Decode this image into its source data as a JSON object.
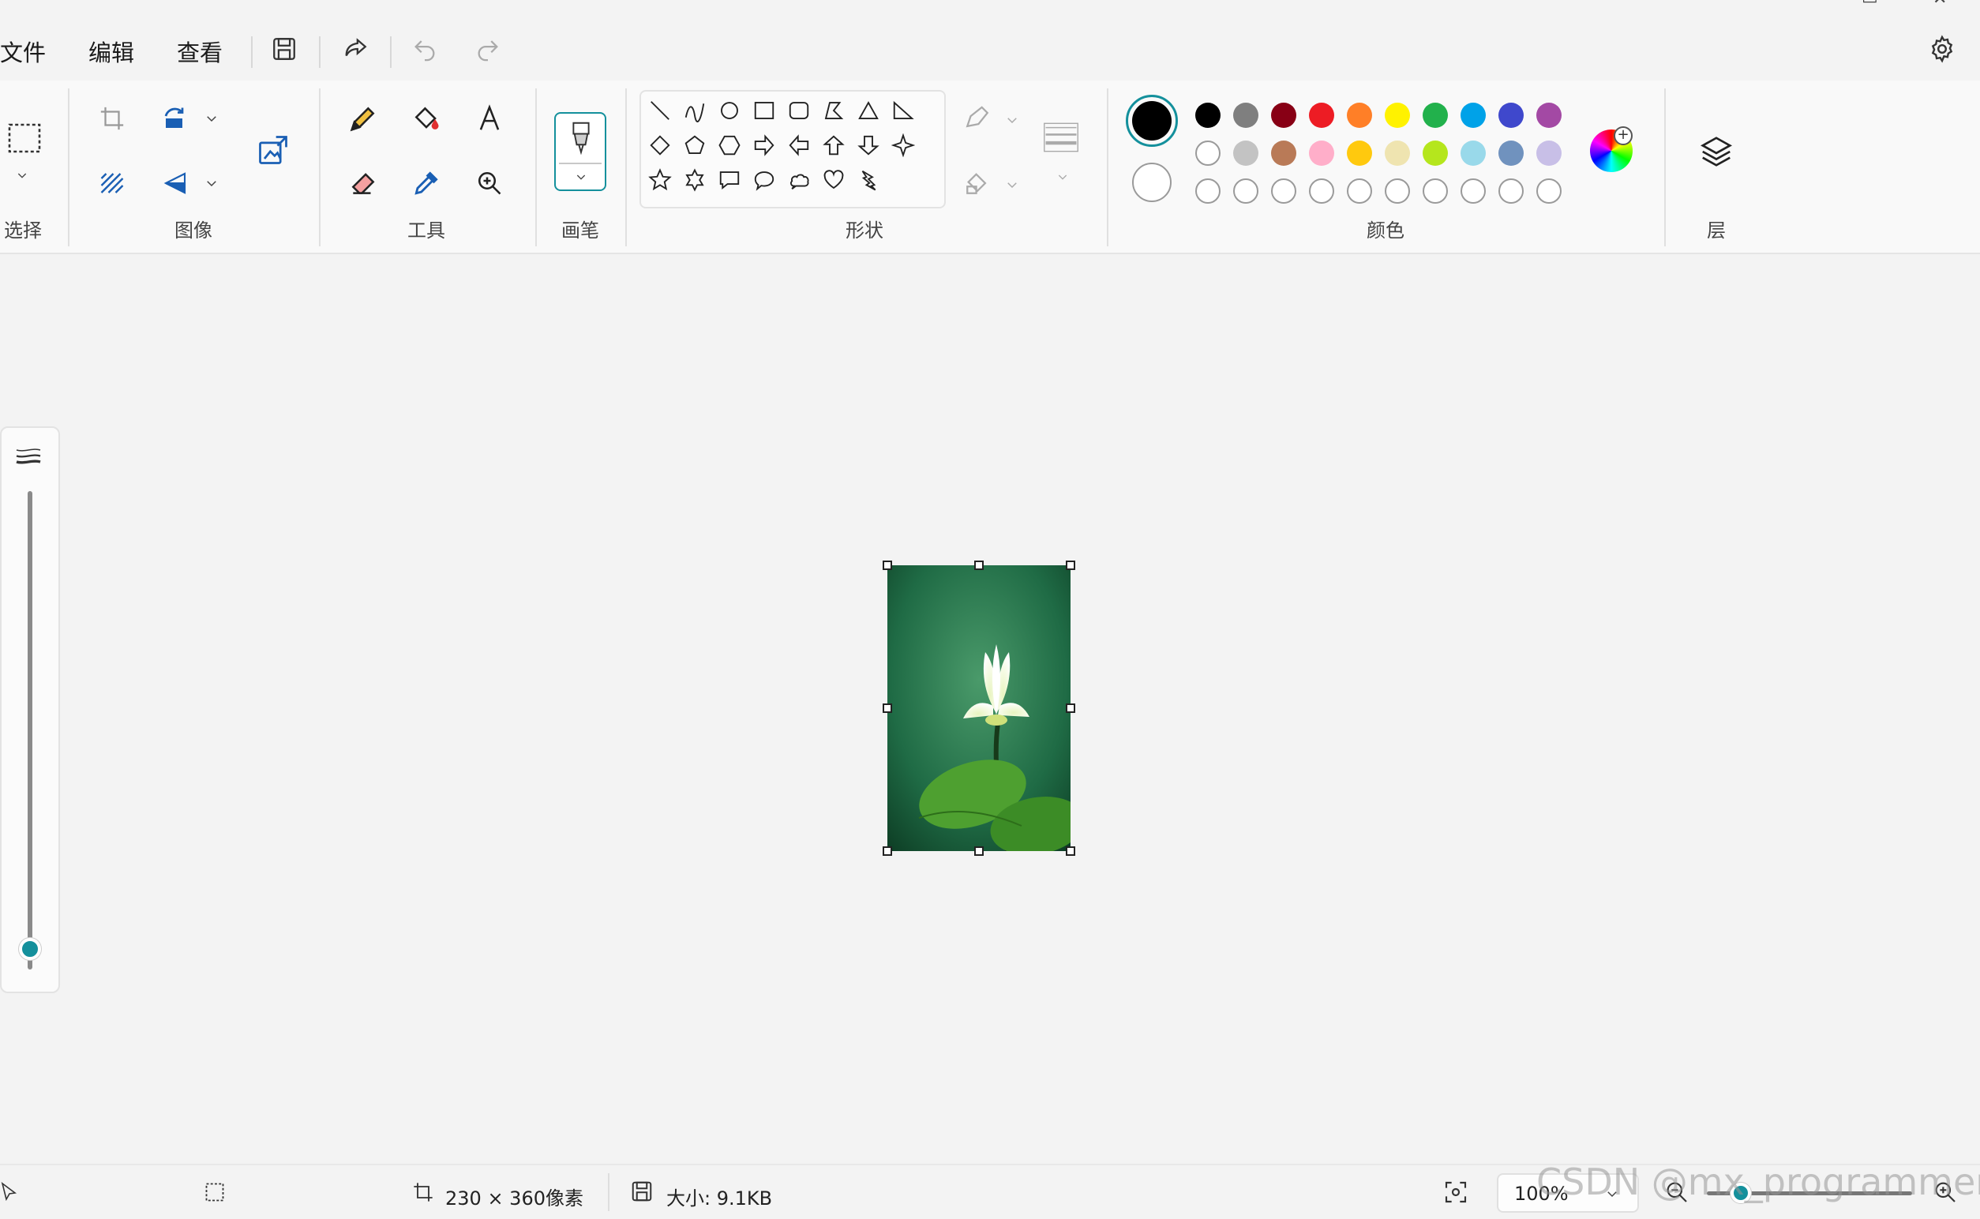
{
  "menubar": {
    "file": "文件",
    "edit": "编辑",
    "view": "查看",
    "icons": [
      "save-icon",
      "share-icon",
      "undo-icon",
      "redo-icon",
      "settings-icon"
    ]
  },
  "ribbon": {
    "groups": {
      "select": "选择",
      "image": "图像",
      "tools": "工具",
      "brushes": "画笔",
      "shapes": "形状",
      "colors": "颜色",
      "layers": "层"
    },
    "shapes_rows": [
      [
        "line",
        "curve",
        "oval",
        "rectangle",
        "rounded-rectangle",
        "polygon",
        "triangle",
        "right-triangle"
      ],
      [
        "diamond",
        "pentagon",
        "hexagon",
        "arrow-right",
        "arrow-left",
        "arrow-up",
        "arrow-down",
        "star4"
      ],
      [
        "star5",
        "star6",
        "callout-rect",
        "callout-oval",
        "callout-cloud",
        "heart",
        "lightning"
      ]
    ],
    "colors": {
      "primary": "#000000",
      "secondary": "#ffffff",
      "row1": [
        "#000000",
        "#7f7f7f",
        "#880015",
        "#ed1c24",
        "#ff7f27",
        "#fff200",
        "#22b14c",
        "#00a2e8",
        "#3f48cc",
        "#a349a4"
      ],
      "row2": [
        "#ffffff",
        "#c3c3c3",
        "#b97a57",
        "#ffaec9",
        "#ffc90e",
        "#efe4b0",
        "#b5e61d",
        "#99d9ea",
        "#7092be",
        "#c8bfe7"
      ],
      "row3_empty_count": 10
    }
  },
  "status": {
    "dimensions": "230 × 360像素",
    "size": "大小: 9.1KB",
    "zoom": "100%"
  },
  "watermark": "CSDN @mx_programmers"
}
